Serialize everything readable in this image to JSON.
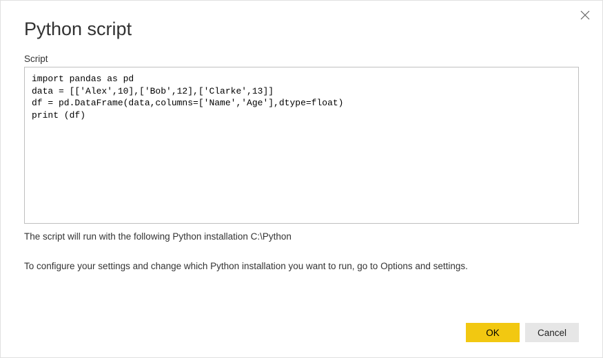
{
  "dialog": {
    "title": "Python script",
    "script_label": "Script",
    "script_content": "import pandas as pd\ndata = [['Alex',10],['Bob',12],['Clarke',13]]\ndf = pd.DataFrame(data,columns=['Name','Age'],dtype=float)\nprint (df)",
    "install_info": "The script will run with the following Python installation C:\\Python",
    "configure_info": "To configure your settings and change which Python installation you want to run, go to Options and settings.",
    "ok_label": "OK",
    "cancel_label": "Cancel"
  }
}
